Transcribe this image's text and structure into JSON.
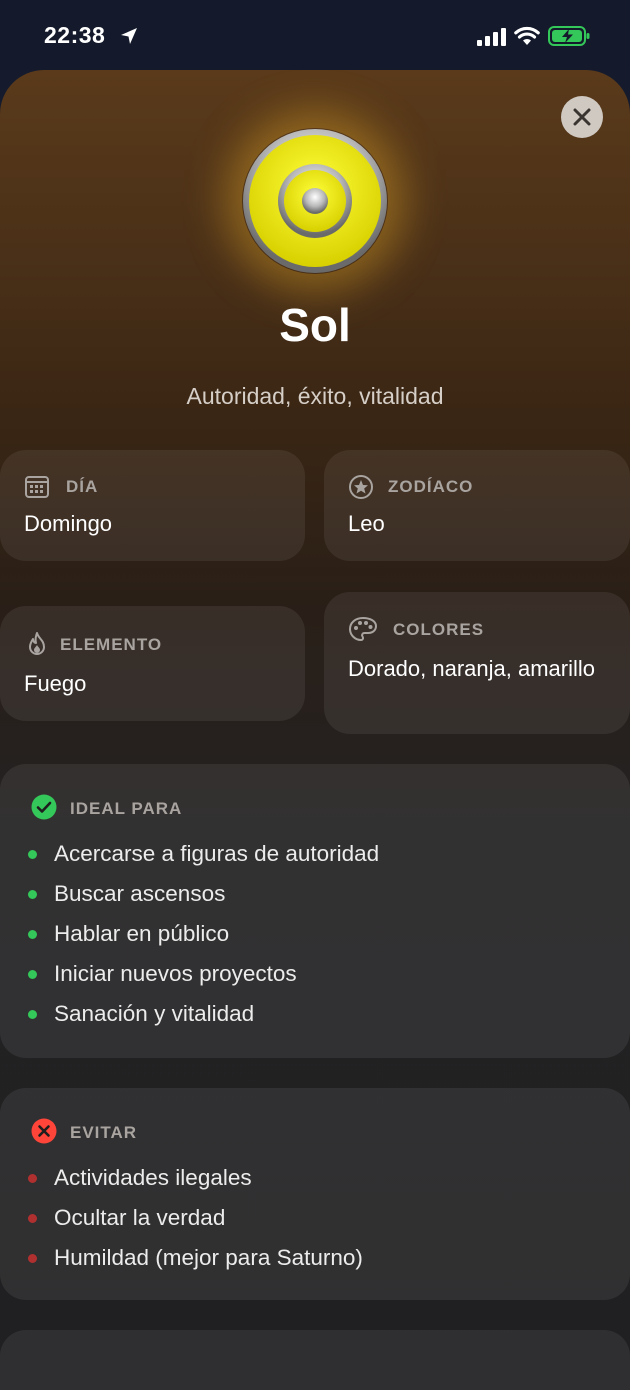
{
  "status_bar": {
    "time": "22:38",
    "icons": [
      "location-arrow-icon",
      "cellular-signal-icon",
      "wifi-icon",
      "battery-charging-icon"
    ]
  },
  "sheet": {
    "close_icon": "close-icon",
    "planet_icon": "sun-symbol-icon",
    "title": "Sol",
    "subtitle": "Autoridad, éxito, vitalidad"
  },
  "info": {
    "dia": {
      "label": "DÍA",
      "value": "Domingo",
      "icon": "calendar-icon"
    },
    "zodiaco": {
      "label": "ZODÍACO",
      "value": "Leo",
      "icon": "star-circle-icon"
    },
    "elemento": {
      "label": "ELEMENTO",
      "value": "Fuego",
      "icon": "flame-icon"
    },
    "colores": {
      "label": "COLORES",
      "value": "Dorado, naranja, amarillo",
      "icon": "palette-icon"
    }
  },
  "ideal": {
    "label": "IDEAL PARA",
    "icon": "checkmark-circle-icon",
    "items": [
      "Acercarse a figuras de autoridad",
      "Buscar ascensos",
      "Hablar en público",
      "Iniciar nuevos proyectos",
      "Sanación y vitalidad"
    ]
  },
  "evitar": {
    "label": "EVITAR",
    "icon": "x-circle-icon",
    "items": [
      "Actividades ilegales",
      "Ocultar la verdad",
      "Humildad (mejor para Saturno)"
    ]
  },
  "colors": {
    "accent_gold": "#e8e600",
    "success": "#34c759",
    "danger": "#ff453a",
    "label_gray": "#a9a4a0"
  }
}
